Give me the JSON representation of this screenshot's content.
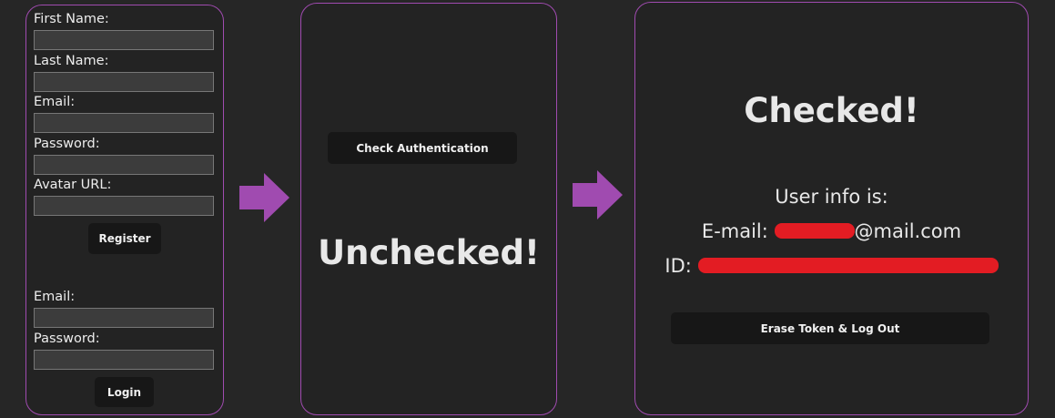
{
  "register_form": {
    "first_name_label": "First Name:",
    "last_name_label": "Last Name:",
    "email_label": "Email:",
    "password_label": "Password:",
    "avatar_url_label": "Avatar URL:",
    "first_name_value": "",
    "last_name_value": "",
    "email_value": "",
    "password_value": "",
    "avatar_url_value": "",
    "register_button": "Register"
  },
  "login_form": {
    "email_label": "Email:",
    "password_label": "Password:",
    "email_value": "",
    "password_value": "",
    "login_button": "Login"
  },
  "auth_panel": {
    "check_button": "Check Authentication",
    "status": "Unchecked!"
  },
  "user_panel": {
    "status": "Checked!",
    "user_info_label": "User info is:",
    "email_prefix": "E-mail:",
    "email_suffix": "@mail.com",
    "id_prefix": "ID:",
    "logout_button": "Erase Token & Log Out"
  },
  "colors": {
    "background": "#262626",
    "panel_border": "#a04bb0",
    "arrow": "#a04bb0",
    "button_bg": "#171717",
    "redaction": "#e31c23"
  },
  "icons": {
    "arrow_1": "arrow-right-icon",
    "arrow_2": "arrow-right-icon"
  }
}
